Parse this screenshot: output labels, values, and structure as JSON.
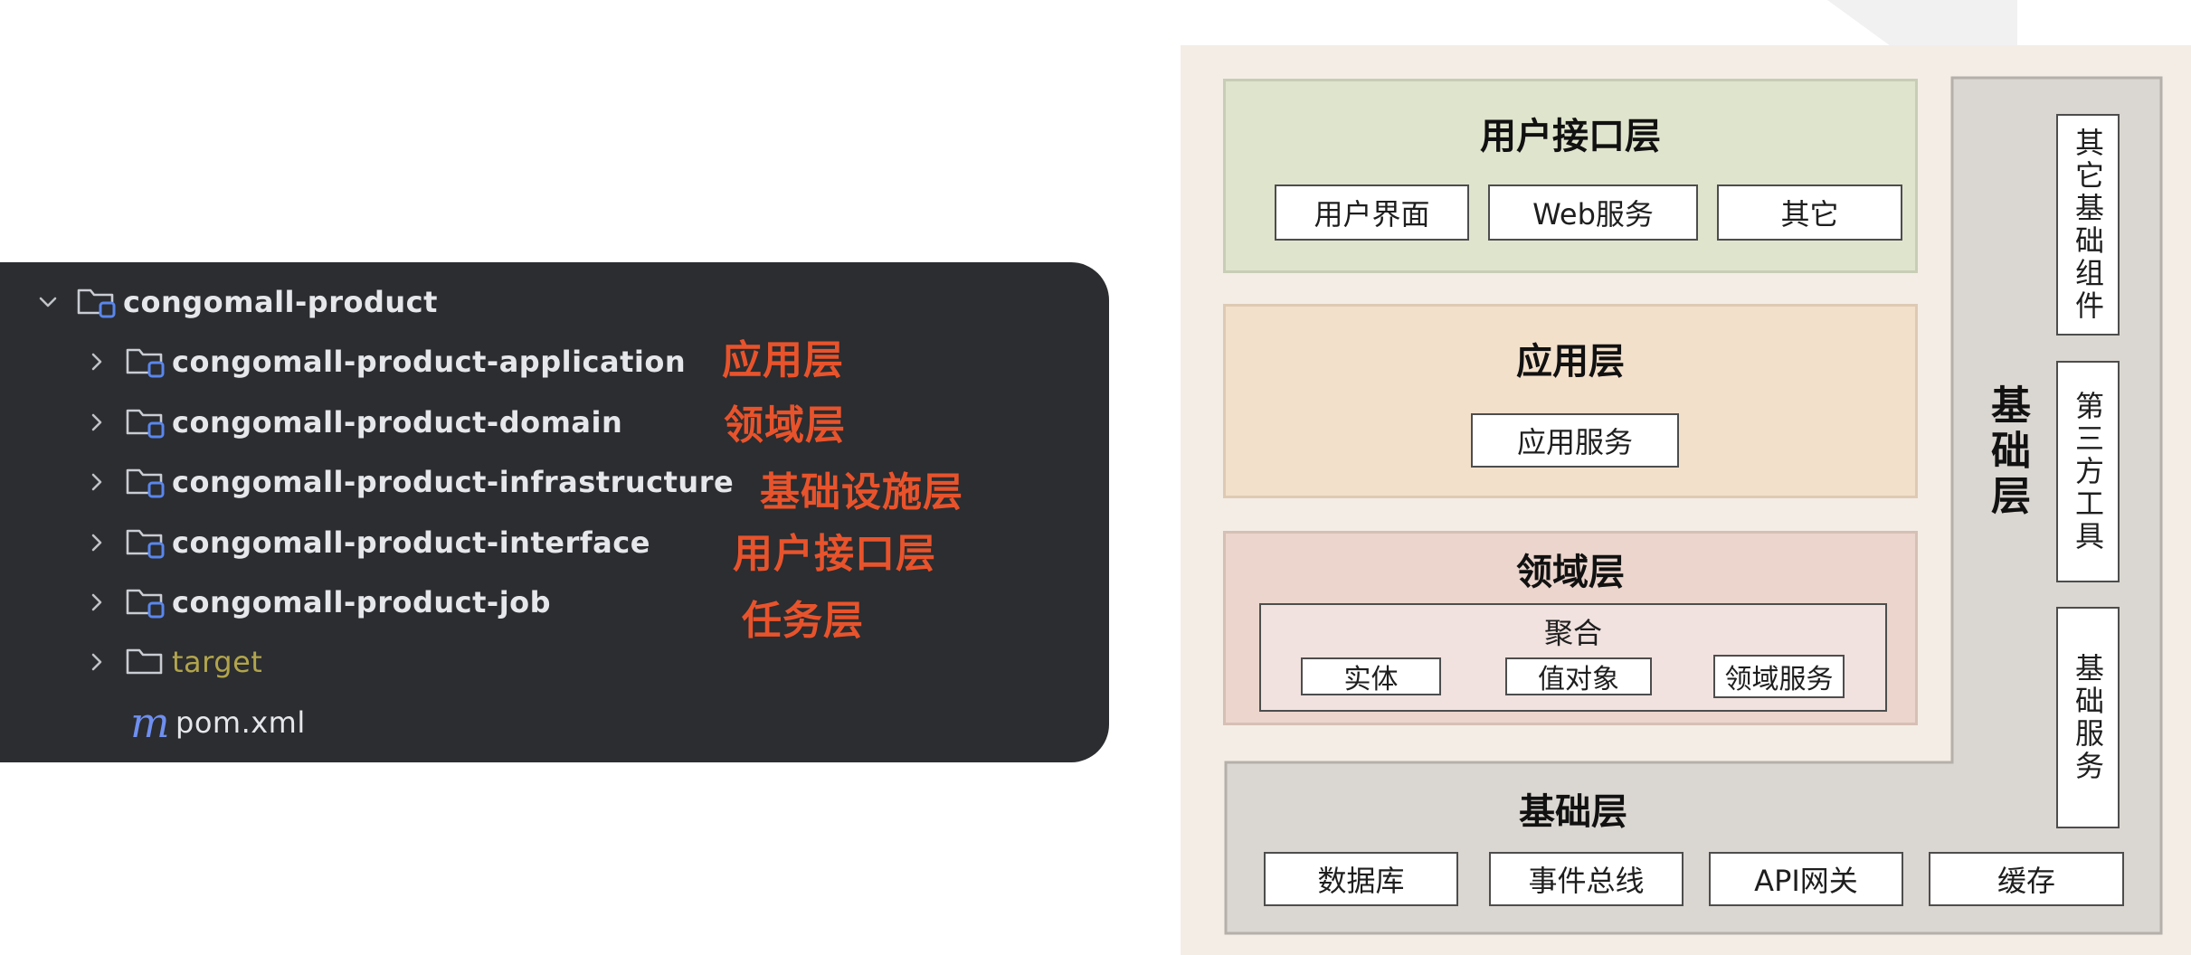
{
  "project_tree": {
    "root": {
      "label": "congomall-product",
      "expanded": true
    },
    "items": [
      {
        "label": "congomall-product-application",
        "type": "module"
      },
      {
        "label": "congomall-product-domain",
        "type": "module"
      },
      {
        "label": "congomall-product-infrastructure",
        "type": "module"
      },
      {
        "label": "congomall-product-interface",
        "type": "module"
      },
      {
        "label": "congomall-product-job",
        "type": "module"
      },
      {
        "label": "target",
        "type": "folder"
      },
      {
        "label": "pom.xml",
        "type": "maven-file"
      }
    ],
    "annotations": [
      "应用层",
      "领域层",
      "基础设施层",
      "用户接口层",
      "任务层"
    ],
    "colors": {
      "panel": "#2b2d30",
      "annotation": "#e8532c",
      "folder_icon": "#c9ccd2",
      "module_badge": "#5a86ec",
      "target_text": "#b2a44c"
    }
  },
  "architecture": {
    "user_interface_layer": {
      "title": "用户接口层",
      "items": [
        "用户界面",
        "Web服务",
        "其它"
      ]
    },
    "application_layer": {
      "title": "应用层",
      "items": [
        "应用服务"
      ]
    },
    "domain_layer": {
      "title": "领域层",
      "aggregate": {
        "title": "聚合",
        "items": [
          "实体",
          "值对象",
          "领域服务"
        ]
      }
    },
    "infrastructure_layer": {
      "title": "基础层",
      "side_title": "基础层",
      "items": [
        "数据库",
        "事件总线",
        "API网关",
        "缓存"
      ],
      "side_items": [
        "其它基础组件",
        "第三方工具",
        "基础服务"
      ]
    },
    "colors": {
      "background": "#f4ede6",
      "ui": "#dfe4cd",
      "app": "#f3e0cb",
      "domain": "#ebd5cc",
      "aggregate": "#f1e2df",
      "infra": "#dad6d1"
    }
  }
}
